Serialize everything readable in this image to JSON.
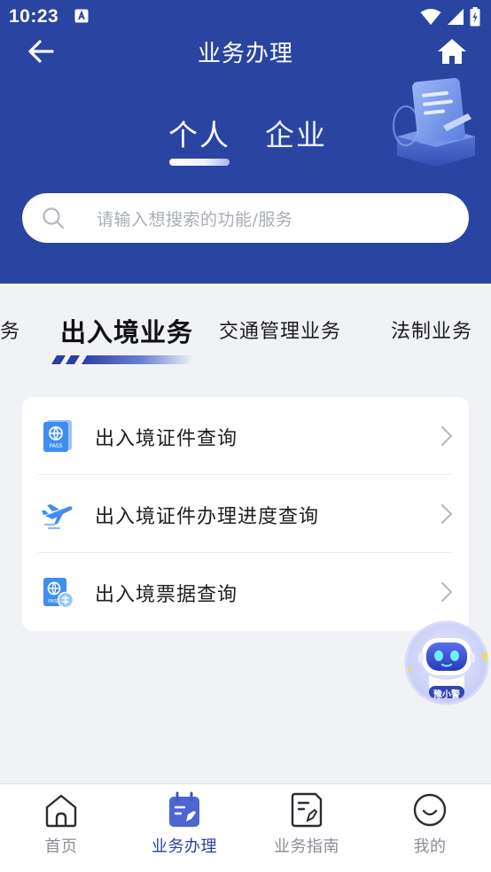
{
  "status_bar": {
    "time": "10:23"
  },
  "nav": {
    "title": "业务办理"
  },
  "type_tabs": [
    {
      "label": "个人",
      "active": true
    },
    {
      "label": "企业",
      "active": false
    }
  ],
  "search": {
    "placeholder": "请输入想搜索的功能/服务"
  },
  "categories": [
    {
      "label": "业务",
      "active": false
    },
    {
      "label": "出入境业务",
      "active": true
    },
    {
      "label": "交通管理业务",
      "active": false
    },
    {
      "label": "法制业务",
      "active": false
    }
  ],
  "services": [
    {
      "label": "出入境证件查询",
      "icon": "passport-icon"
    },
    {
      "label": "出入境证件办理进度查询",
      "icon": "airplane-icon"
    },
    {
      "label": "出入境票据查询",
      "icon": "passport-ticket-icon"
    }
  ],
  "assistant": {
    "badge": "豫小警"
  },
  "bottom_nav": [
    {
      "label": "首页",
      "icon": "home-icon",
      "active": false
    },
    {
      "label": "业务办理",
      "icon": "calendar-icon",
      "active": true
    },
    {
      "label": "业务指南",
      "icon": "document-icon",
      "active": false
    },
    {
      "label": "我的",
      "icon": "smile-icon",
      "active": false
    }
  ],
  "colors": {
    "header_bg": "#2a44a2",
    "accent": "#2b3fa0",
    "page_bg": "#f1f2f6",
    "icon_blue": "#3f8ef0"
  }
}
